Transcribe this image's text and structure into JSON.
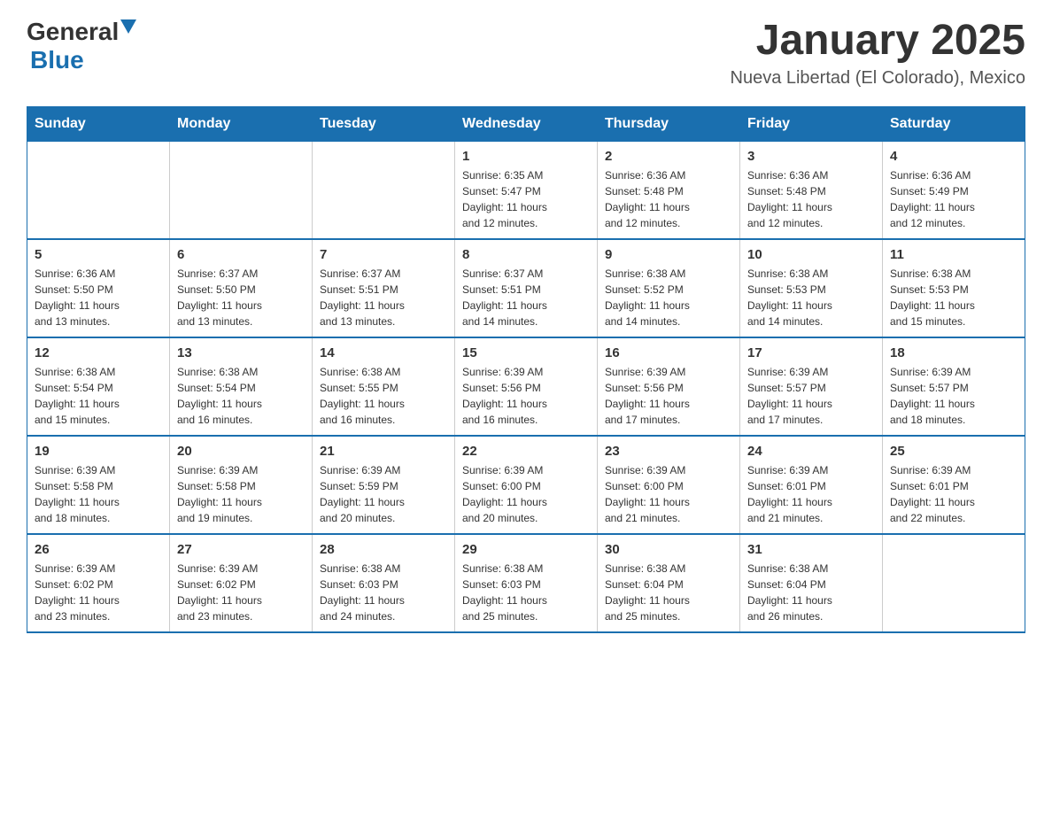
{
  "header": {
    "logo": {
      "general": "General",
      "blue": "Blue"
    },
    "title": "January 2025",
    "location": "Nueva Libertad (El Colorado), Mexico"
  },
  "calendar": {
    "days_of_week": [
      "Sunday",
      "Monday",
      "Tuesday",
      "Wednesday",
      "Thursday",
      "Friday",
      "Saturday"
    ],
    "weeks": [
      [
        {
          "day": "",
          "info": ""
        },
        {
          "day": "",
          "info": ""
        },
        {
          "day": "",
          "info": ""
        },
        {
          "day": "1",
          "info": "Sunrise: 6:35 AM\nSunset: 5:47 PM\nDaylight: 11 hours\nand 12 minutes."
        },
        {
          "day": "2",
          "info": "Sunrise: 6:36 AM\nSunset: 5:48 PM\nDaylight: 11 hours\nand 12 minutes."
        },
        {
          "day": "3",
          "info": "Sunrise: 6:36 AM\nSunset: 5:48 PM\nDaylight: 11 hours\nand 12 minutes."
        },
        {
          "day": "4",
          "info": "Sunrise: 6:36 AM\nSunset: 5:49 PM\nDaylight: 11 hours\nand 12 minutes."
        }
      ],
      [
        {
          "day": "5",
          "info": "Sunrise: 6:36 AM\nSunset: 5:50 PM\nDaylight: 11 hours\nand 13 minutes."
        },
        {
          "day": "6",
          "info": "Sunrise: 6:37 AM\nSunset: 5:50 PM\nDaylight: 11 hours\nand 13 minutes."
        },
        {
          "day": "7",
          "info": "Sunrise: 6:37 AM\nSunset: 5:51 PM\nDaylight: 11 hours\nand 13 minutes."
        },
        {
          "day": "8",
          "info": "Sunrise: 6:37 AM\nSunset: 5:51 PM\nDaylight: 11 hours\nand 14 minutes."
        },
        {
          "day": "9",
          "info": "Sunrise: 6:38 AM\nSunset: 5:52 PM\nDaylight: 11 hours\nand 14 minutes."
        },
        {
          "day": "10",
          "info": "Sunrise: 6:38 AM\nSunset: 5:53 PM\nDaylight: 11 hours\nand 14 minutes."
        },
        {
          "day": "11",
          "info": "Sunrise: 6:38 AM\nSunset: 5:53 PM\nDaylight: 11 hours\nand 15 minutes."
        }
      ],
      [
        {
          "day": "12",
          "info": "Sunrise: 6:38 AM\nSunset: 5:54 PM\nDaylight: 11 hours\nand 15 minutes."
        },
        {
          "day": "13",
          "info": "Sunrise: 6:38 AM\nSunset: 5:54 PM\nDaylight: 11 hours\nand 16 minutes."
        },
        {
          "day": "14",
          "info": "Sunrise: 6:38 AM\nSunset: 5:55 PM\nDaylight: 11 hours\nand 16 minutes."
        },
        {
          "day": "15",
          "info": "Sunrise: 6:39 AM\nSunset: 5:56 PM\nDaylight: 11 hours\nand 16 minutes."
        },
        {
          "day": "16",
          "info": "Sunrise: 6:39 AM\nSunset: 5:56 PM\nDaylight: 11 hours\nand 17 minutes."
        },
        {
          "day": "17",
          "info": "Sunrise: 6:39 AM\nSunset: 5:57 PM\nDaylight: 11 hours\nand 17 minutes."
        },
        {
          "day": "18",
          "info": "Sunrise: 6:39 AM\nSunset: 5:57 PM\nDaylight: 11 hours\nand 18 minutes."
        }
      ],
      [
        {
          "day": "19",
          "info": "Sunrise: 6:39 AM\nSunset: 5:58 PM\nDaylight: 11 hours\nand 18 minutes."
        },
        {
          "day": "20",
          "info": "Sunrise: 6:39 AM\nSunset: 5:58 PM\nDaylight: 11 hours\nand 19 minutes."
        },
        {
          "day": "21",
          "info": "Sunrise: 6:39 AM\nSunset: 5:59 PM\nDaylight: 11 hours\nand 20 minutes."
        },
        {
          "day": "22",
          "info": "Sunrise: 6:39 AM\nSunset: 6:00 PM\nDaylight: 11 hours\nand 20 minutes."
        },
        {
          "day": "23",
          "info": "Sunrise: 6:39 AM\nSunset: 6:00 PM\nDaylight: 11 hours\nand 21 minutes."
        },
        {
          "day": "24",
          "info": "Sunrise: 6:39 AM\nSunset: 6:01 PM\nDaylight: 11 hours\nand 21 minutes."
        },
        {
          "day": "25",
          "info": "Sunrise: 6:39 AM\nSunset: 6:01 PM\nDaylight: 11 hours\nand 22 minutes."
        }
      ],
      [
        {
          "day": "26",
          "info": "Sunrise: 6:39 AM\nSunset: 6:02 PM\nDaylight: 11 hours\nand 23 minutes."
        },
        {
          "day": "27",
          "info": "Sunrise: 6:39 AM\nSunset: 6:02 PM\nDaylight: 11 hours\nand 23 minutes."
        },
        {
          "day": "28",
          "info": "Sunrise: 6:38 AM\nSunset: 6:03 PM\nDaylight: 11 hours\nand 24 minutes."
        },
        {
          "day": "29",
          "info": "Sunrise: 6:38 AM\nSunset: 6:03 PM\nDaylight: 11 hours\nand 25 minutes."
        },
        {
          "day": "30",
          "info": "Sunrise: 6:38 AM\nSunset: 6:04 PM\nDaylight: 11 hours\nand 25 minutes."
        },
        {
          "day": "31",
          "info": "Sunrise: 6:38 AM\nSunset: 6:04 PM\nDaylight: 11 hours\nand 26 minutes."
        },
        {
          "day": "",
          "info": ""
        }
      ]
    ]
  }
}
